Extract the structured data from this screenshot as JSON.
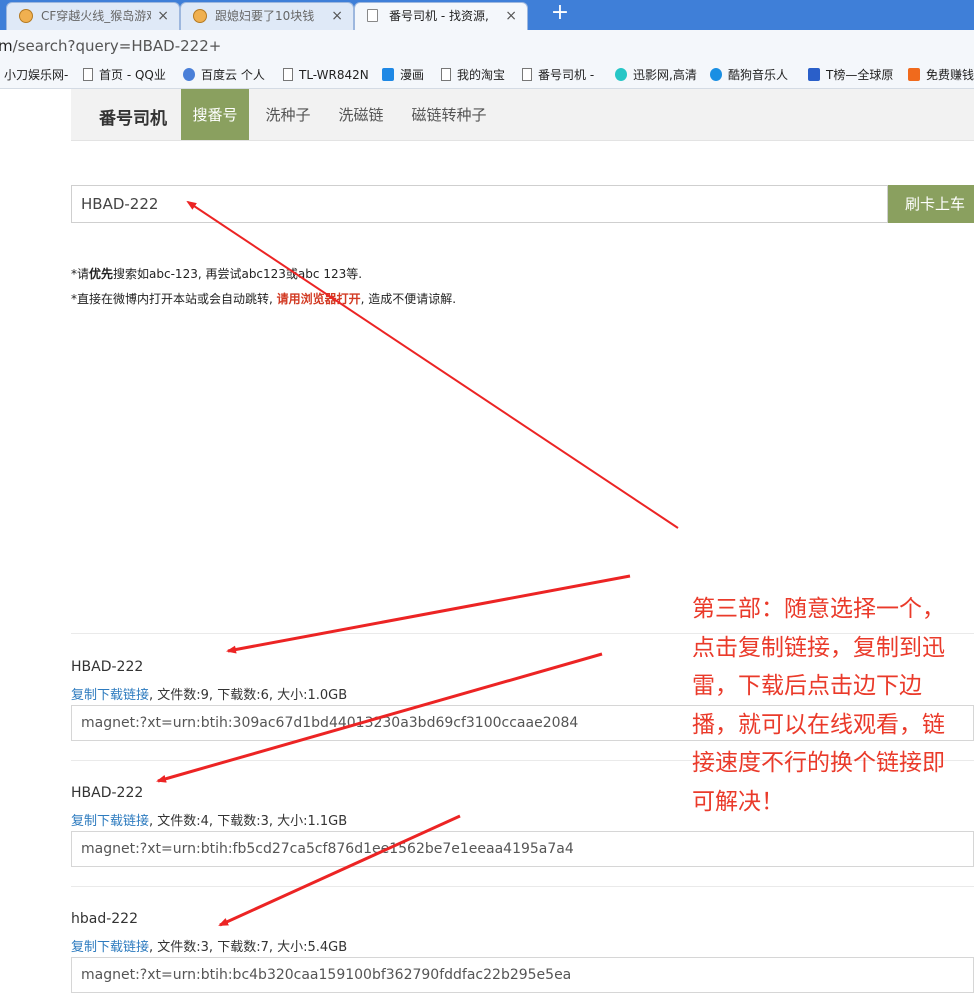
{
  "tabs": [
    {
      "label": "CF穿越火线_猴岛游戏",
      "close": "×"
    },
    {
      "label": "跟媳妇要了10块钱",
      "close": "×"
    },
    {
      "label": "番号司机 - 找资源,",
      "close": "×"
    }
  ],
  "new_tab": "+",
  "address": {
    "prefix": "m",
    "path": "/search?query=HBAD-222+"
  },
  "bookmarks": [
    {
      "label": "小刀娱乐网-",
      "icon": "none"
    },
    {
      "label": "首页 - QQ业",
      "icon": "page-icon"
    },
    {
      "label": "百度云 个人",
      "icon": "baidu-cloud-icon"
    },
    {
      "label": "TL-WR842N",
      "icon": "page-icon"
    },
    {
      "label": "漫画",
      "icon": "camera-icon"
    },
    {
      "label": "我的淘宝",
      "icon": "page-icon"
    },
    {
      "label": "番号司机 -",
      "icon": "page-icon"
    },
    {
      "label": "迅影网,高清",
      "icon": "play-icon"
    },
    {
      "label": "酷狗音乐人",
      "icon": "kugou-icon"
    },
    {
      "label": "T榜—全球原",
      "icon": "t-icon"
    },
    {
      "label": "免费赚钱",
      "icon": "1927-icon"
    }
  ],
  "site_nav": {
    "brand": "番号司机",
    "items": [
      "搜番号",
      "洗种子",
      "洗磁链",
      "磁链转种子"
    ],
    "active": 0
  },
  "search": {
    "value": "HBAD-222",
    "button": "刷卡上车"
  },
  "notes": {
    "line1_a": "*请",
    "line1_b": "优先",
    "line1_c": "搜索如abc-123, 再尝试abc123或abc 123等.",
    "line2_a": "*直接在微博内打开本站或会自动跳转, ",
    "line2_red": "请用浏览器打开",
    "line2_c": ", 造成不便请谅解."
  },
  "results": [
    {
      "title": "HBAD-222",
      "copy": "复制下载链接",
      "meta": ", 文件数:9, 下载数:6, 大小:1.0GB",
      "magnet": "magnet:?xt=urn:btih:309ac67d1bd44013230a3bd69cf3100ccaae2084"
    },
    {
      "title": "HBAD-222",
      "copy": "复制下载链接",
      "meta": ", 文件数:4, 下载数:3, 大小:1.1GB",
      "magnet": "magnet:?xt=urn:btih:fb5cd27ca5cf876d1ee1562be7e1eeaa4195a7a4"
    },
    {
      "title": "hbad-222",
      "copy": "复制下载链接",
      "meta": ", 文件数:3, 下载数:7, 大小:5.4GB",
      "magnet": "magnet:?xt=urn:btih:bc4b320caa159100bf362790fddfac22b295e5ea"
    }
  ],
  "annotation": "第三部：随意选择一个，点击复制链接，复制到迅雷，下载后点击边下边播，就可以在线观看，链接速度不行的换个链接即可解决！",
  "colors": {
    "accent": "#8aa05f",
    "link": "#2d7bbf",
    "annotation": "#ea3a2a",
    "tabbar": "#3f7fd8"
  }
}
